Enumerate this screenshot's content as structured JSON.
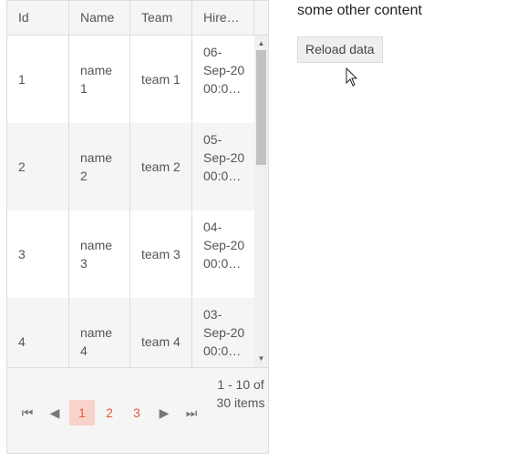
{
  "grid": {
    "columns": [
      "Id",
      "Name",
      "Team",
      "Hire…"
    ],
    "rows": [
      {
        "id": "1",
        "name": "name 1",
        "team": "team 1",
        "hire": "06-Sep-20 00:0…"
      },
      {
        "id": "2",
        "name": "name 2",
        "team": "team 2",
        "hire": "05-Sep-20 00:0…"
      },
      {
        "id": "3",
        "name": "name 3",
        "team": "team 3",
        "hire": "04-Sep-20 00:0…"
      },
      {
        "id": "4",
        "name": "name 4",
        "team": "team 4",
        "hire": "03-Sep-20 00:0…"
      }
    ],
    "pager": {
      "first": "⏮",
      "prev": "◀",
      "pages": [
        "1",
        "2",
        "3"
      ],
      "current_page": "1",
      "next": "▶",
      "last": "⏭",
      "info": "1 - 10 of 30 items"
    }
  },
  "side": {
    "text": "some other content",
    "reload_label": "Reload data"
  }
}
